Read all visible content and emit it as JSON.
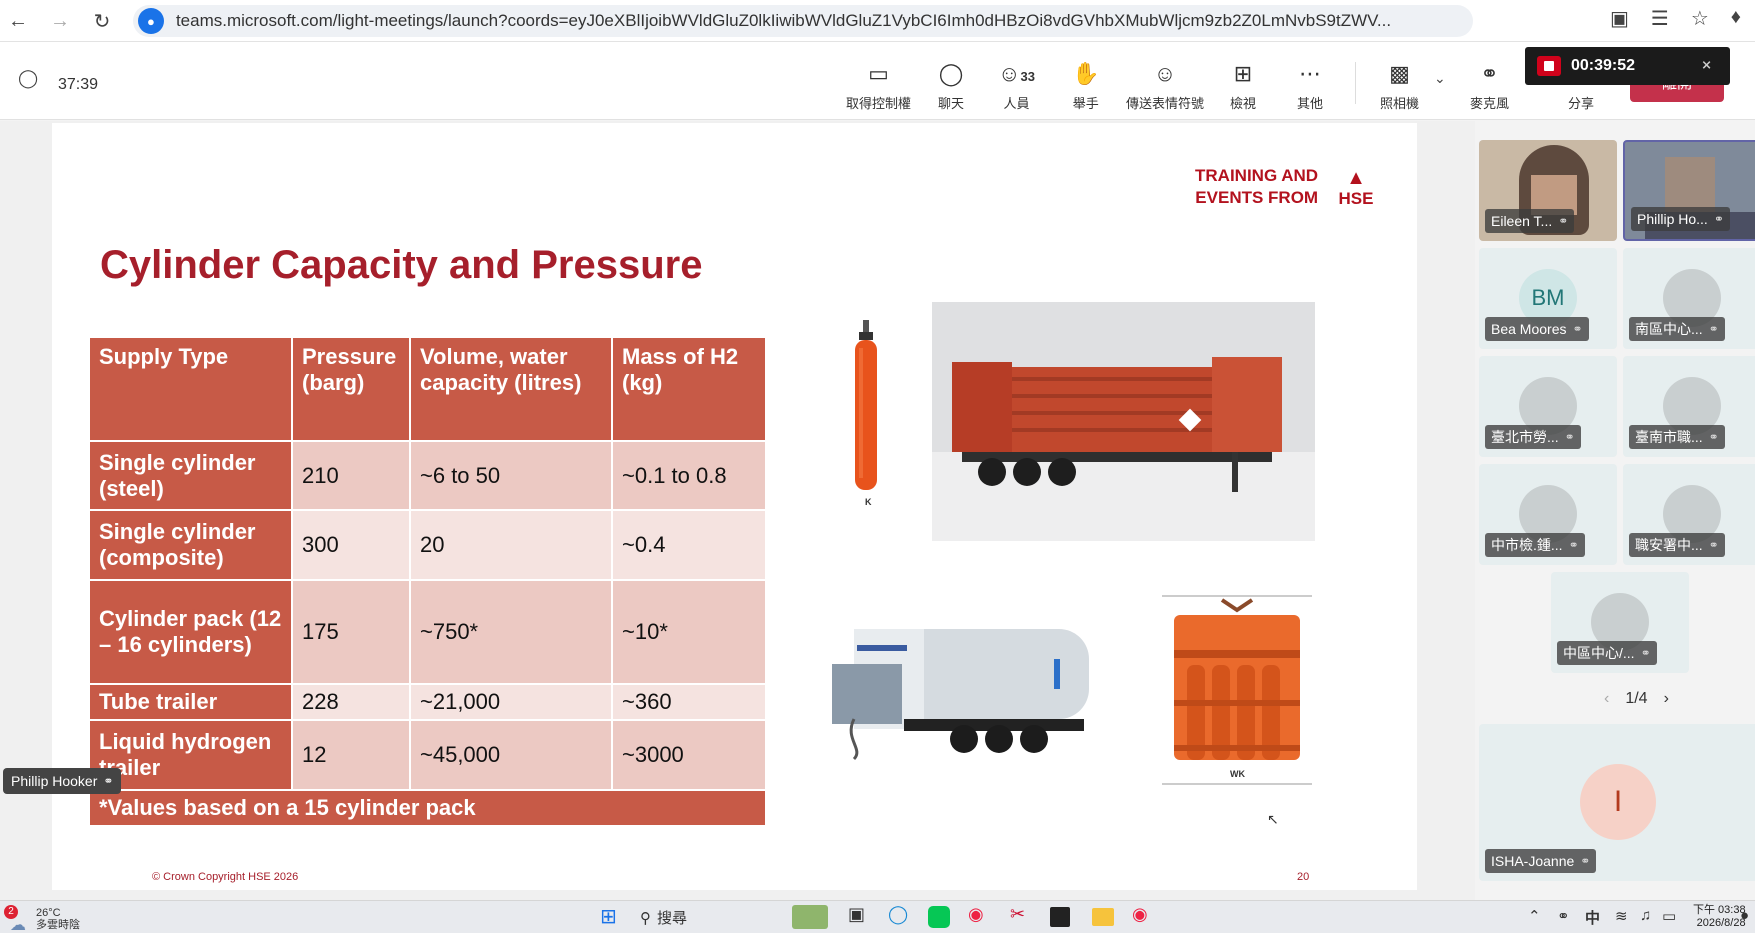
{
  "browser": {
    "url": "teams.microsoft.com/light-meetings/launch?coords=eyJ0eXBlIjoibWVldGluZ0lkIiwibWVldGluZ1VybCI6Imh0dHBzOi8vdGVhbXMubWljcm9zb2Z0LmNvbS9tZWV..."
  },
  "meeting": {
    "elapsed": "37:39",
    "toolbar": [
      {
        "label": "取得控制權",
        "icon": "share-screen-icon"
      },
      {
        "label": "聊天",
        "icon": "chat-icon"
      },
      {
        "label": "人員",
        "icon": "people-icon",
        "count": "33"
      },
      {
        "label": "舉手",
        "icon": "raise-hand-icon"
      },
      {
        "label": "傳送表情符號",
        "icon": "emoji-icon"
      },
      {
        "label": "檢視",
        "icon": "grid-view-icon"
      },
      {
        "label": "其他",
        "icon": "more-icon"
      },
      {
        "label": "照相機",
        "icon": "camera-off-icon"
      },
      {
        "label": "麥克風",
        "icon": "mic-off-icon"
      },
      {
        "label": "分享",
        "icon": "share-icon"
      }
    ],
    "leave_label": "離開",
    "recording_time": "00:39:52"
  },
  "slide": {
    "logo_line1": "TRAINING AND",
    "logo_line2": "EVENTS FROM",
    "logo_brand": "HSE",
    "title": "Cylinder Capacity and Pressure",
    "table": {
      "headers": [
        "Supply Type",
        "Pressure (barg)",
        "Volume, water capacity (litres)",
        "Mass of H2 (kg)"
      ],
      "rows": [
        [
          "Single cylinder (steel)",
          "210",
          "~6 to 50",
          "~0.1 to 0.8"
        ],
        [
          "Single cylinder (composite)",
          "300",
          "20",
          "~0.4"
        ],
        [
          "Cylinder pack (12 – 16 cylinders)",
          "175",
          "~750*",
          "~10*"
        ],
        [
          "Tube trailer",
          "228",
          "~21,000",
          "~360"
        ],
        [
          "Liquid hydrogen trailer",
          "12",
          "~45,000",
          "~3000"
        ]
      ],
      "note": "*Values based on a 15 cylinder pack"
    },
    "img_label_k": "K",
    "img_label_wk": "WK",
    "copyright": "© Crown Copyright HSE 2026",
    "page": "20"
  },
  "presenter_label": "Phillip Hooker",
  "participants": [
    {
      "name": "Eileen T...",
      "type": "video"
    },
    {
      "name": "Phillip Ho...",
      "type": "video"
    },
    {
      "name": "Bea Moores",
      "initials": "BM",
      "type": "initials"
    },
    {
      "name": "南區中心...",
      "type": "avatar"
    },
    {
      "name": "臺北市勞...",
      "type": "avatar"
    },
    {
      "name": "臺南市職...",
      "type": "avatar"
    },
    {
      "name": "中市檢.鍾...",
      "type": "avatar"
    },
    {
      "name": "職安署中...",
      "type": "avatar"
    },
    {
      "name": "中區中心/...",
      "type": "avatar"
    }
  ],
  "pager": "1/4",
  "spotlight": {
    "name": "ISHA-Joanne",
    "initial": "I"
  },
  "taskbar": {
    "weather_temp": "26°C",
    "weather_desc": "多雲時陰",
    "weather_badge": "2",
    "search_label": "搜尋",
    "ime": "中",
    "time": "下午 03:38",
    "date": "2026/8/28"
  }
}
